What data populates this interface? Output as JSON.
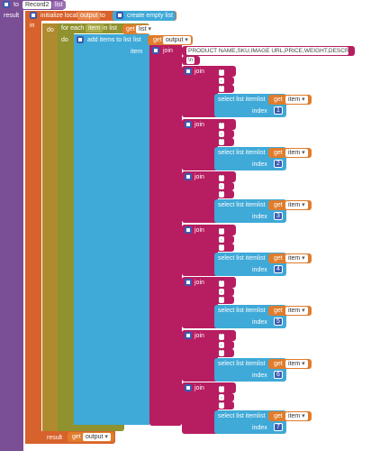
{
  "procedure": {
    "keyword": "to",
    "name": "Record2",
    "param": "list",
    "result_label": "result"
  },
  "init_local": {
    "keyword": "initialize local",
    "var": "output",
    "to": "to",
    "value": "create empty list",
    "in": "in"
  },
  "foreach": {
    "do_outer": "do",
    "label": "for each",
    "item": "item",
    "in_list": "in list",
    "get": "get",
    "list": "list",
    "do": "do"
  },
  "additems": {
    "label": "add items to list",
    "list_label": "list",
    "get": "get",
    "var": "output",
    "item_label": "item"
  },
  "join_main": {
    "label": "join"
  },
  "header_string": "PRODUCT NAME,SKU,IMAGE URL,PRICE,WEIGHT,DESCRIPT",
  "newline_string": "\\n",
  "joins": [
    {
      "join": "join",
      "q1": "\"",
      "comma": ",",
      "q2": "\"",
      "select": "select list item",
      "list": "list",
      "get": "get",
      "var": "item",
      "index_label": "index",
      "index": "1"
    },
    {
      "join": "join",
      "q1": "\"",
      "comma": ",",
      "q2": "\"",
      "select": "select list item",
      "list": "list",
      "get": "get",
      "var": "item",
      "index_label": "index",
      "index": "2"
    },
    {
      "join": "join",
      "q1": "\"",
      "comma": ",",
      "q2": "\"",
      "select": "select list item",
      "list": "list",
      "get": "get",
      "var": "item",
      "index_label": "index",
      "index": "3"
    },
    {
      "join": "join",
      "q1": "\"",
      "comma": ",",
      "q2": "\"",
      "select": "select list item",
      "list": "list",
      "get": "get",
      "var": "item",
      "index_label": "index",
      "index": "4"
    },
    {
      "join": "join",
      "q1": "\"",
      "comma": ",",
      "q2": "\"",
      "select": "select list item",
      "list": "list",
      "get": "get",
      "var": "item",
      "index_label": "index",
      "index": "5"
    },
    {
      "join": "join",
      "q1": "\"",
      "comma": ",",
      "q2": "\"",
      "select": "select list item",
      "list": "list",
      "get": "get",
      "var": "item",
      "index_label": "index",
      "index": "6"
    },
    {
      "join": "join",
      "q1": "\"",
      "comma": ",",
      "q2": "\"",
      "select": "select list item",
      "list": "list",
      "get": "get",
      "var": "item",
      "index_label": "index",
      "index": "7"
    }
  ],
  "bottom_result": {
    "label": "result",
    "get": "get",
    "var": "output"
  }
}
